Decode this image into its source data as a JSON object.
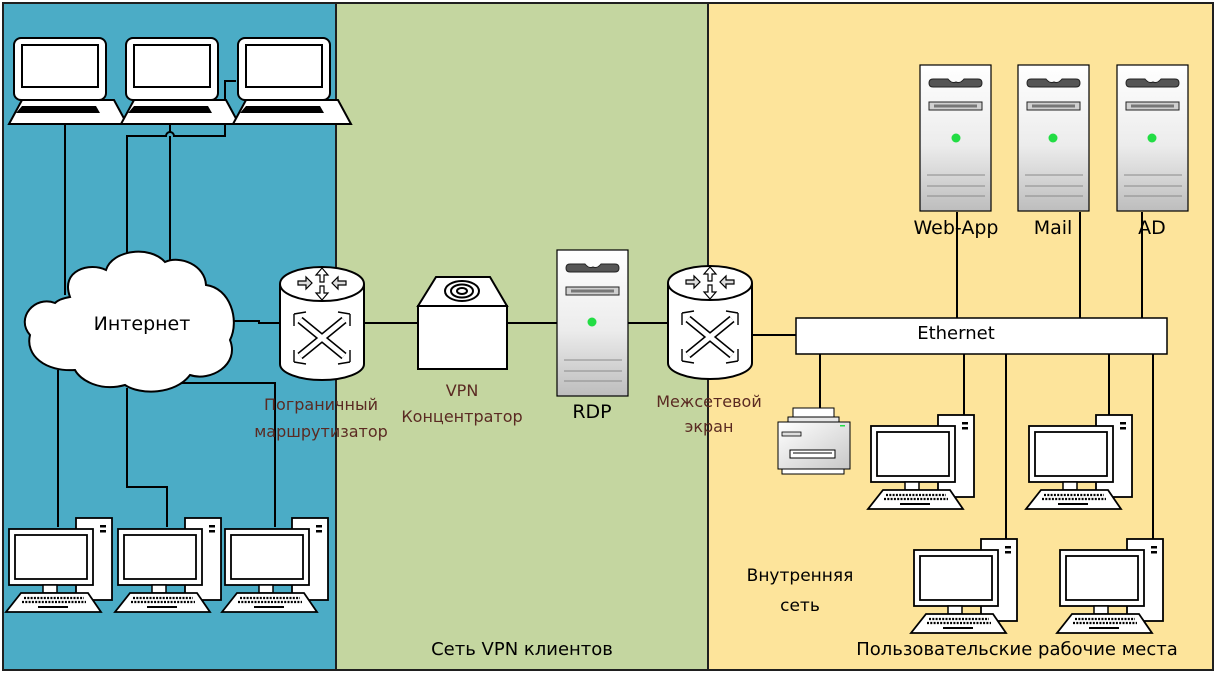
{
  "zones": [
    {
      "id": "internet-zone",
      "label": "",
      "color": "#4bacc6"
    },
    {
      "id": "vpn-zone",
      "label": "Сеть VPN клиентов",
      "color": "#c4d6a0"
    },
    {
      "id": "internal-zone",
      "label": "Пользовательские рабочие места",
      "color": "#fde49b"
    }
  ],
  "labels": {
    "internet": "Интернет",
    "border_router_line1": "Пограничный",
    "border_router_line2": "маршрутизатор",
    "vpn_concentrator_line1": "VPN",
    "vpn_concentrator_line2": "Концентратор",
    "rdp": "RDP",
    "firewall_line1": "Межсетевой",
    "firewall_line2": "экран",
    "ethernet": "Ethernet",
    "internal_network_line1": "Внутренняя",
    "internal_network_line2": "сеть",
    "vpn_zone_title": "Сеть VPN клиентов",
    "workstations_title": "Пользовательские рабочие места"
  },
  "servers": [
    {
      "name": "Web-App",
      "status_color": "#22dd44"
    },
    {
      "name": "Mail",
      "status_color": "#22dd44"
    },
    {
      "name": "AD",
      "status_color": "#22dd44"
    }
  ],
  "rdp_server": {
    "name": "RDP",
    "status_color": "#22dd44"
  },
  "remote_clients": {
    "laptops": 3,
    "desktops": 3
  },
  "internal_devices": {
    "printers": 1,
    "workstations": 4
  }
}
